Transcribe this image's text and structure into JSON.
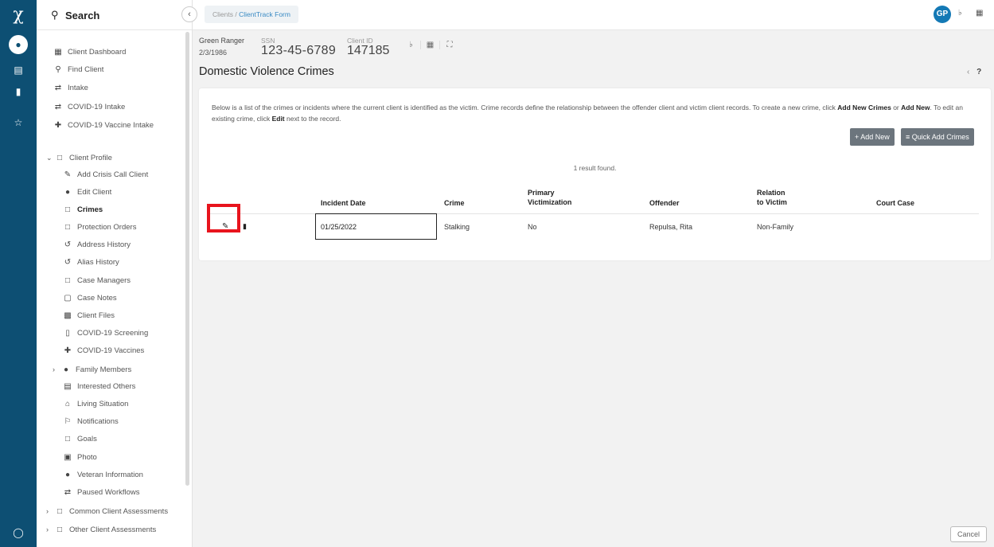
{
  "rail": {
    "icons": [
      "logo",
      "users-icon",
      "id-card-icon",
      "document-icon",
      "star-icon",
      "help-icon"
    ]
  },
  "sidebar": {
    "search_label": "Search",
    "top_items": [
      {
        "label": "Client Dashboard",
        "icon": "map-icon"
      },
      {
        "label": "Find Client",
        "icon": "search-icon"
      },
      {
        "label": "Intake",
        "icon": "workflow-icon"
      },
      {
        "label": "COVID-19 Intake",
        "icon": "workflow-icon"
      },
      {
        "label": "COVID-19 Vaccine Intake",
        "icon": "syringe-icon"
      }
    ],
    "section_label": "Client Profile",
    "profile_items": [
      {
        "label": "Add Crisis Call Client",
        "icon": "user-edit-icon"
      },
      {
        "label": "Edit Client",
        "icon": "user-icon"
      },
      {
        "label": "Crimes",
        "icon": "folder-icon",
        "active": true
      },
      {
        "label": "Protection Orders",
        "icon": "folder-icon"
      },
      {
        "label": "Address History",
        "icon": "history-icon"
      },
      {
        "label": "Alias History",
        "icon": "history-icon"
      },
      {
        "label": "Case Managers",
        "icon": "folder-icon"
      },
      {
        "label": "Case Notes",
        "icon": "note-icon"
      },
      {
        "label": "Client Files",
        "icon": "file-icon"
      },
      {
        "label": "COVID-19 Screening",
        "icon": "clipboard-icon"
      },
      {
        "label": "COVID-19 Vaccines",
        "icon": "syringe-icon"
      },
      {
        "label": "Family Members",
        "icon": "user-icon"
      },
      {
        "label": "Interested Others",
        "icon": "id-card-icon"
      },
      {
        "label": "Living Situation",
        "icon": "home-icon"
      },
      {
        "label": "Notifications",
        "icon": "flag-icon"
      },
      {
        "label": "Goals",
        "icon": "folder-icon"
      },
      {
        "label": "Photo",
        "icon": "image-icon"
      },
      {
        "label": "Veteran Information",
        "icon": "users-icon"
      },
      {
        "label": "Paused Workflows",
        "icon": "workflow-icon"
      }
    ],
    "bottom_items": [
      {
        "label": "Common Client Assessments"
      },
      {
        "label": "Other Client Assessments"
      }
    ]
  },
  "topbar": {
    "breadcrumb_root": "Clients",
    "breadcrumb_sep": "/",
    "breadcrumb_current": "ClientTrack Form",
    "avatar_initials": "GP"
  },
  "client": {
    "name": "Green Ranger",
    "dob": "2/3/1986",
    "ssn_label": "SSN",
    "ssn": "123-45-6789",
    "id_label": "Client ID",
    "id": "147185"
  },
  "page": {
    "title": "Domestic Violence Crimes",
    "intro_part1": "Below is a list of the crimes or incidents where the current client is identified as the victim.  Crime records define the relationship between the offender client and victim client records.  To create a new crime, click ",
    "intro_bold1": "Add New Crimes",
    "intro_part2": " or ",
    "intro_bold2": "Add New",
    "intro_part3": ".  To edit an existing crime, click ",
    "intro_bold3": "Edit",
    "intro_part4": " next to the record.",
    "add_new_label": "Add New",
    "quick_add_label": "Quick Add Crimes",
    "result_count": "1 result found.",
    "cancel_label": "Cancel"
  },
  "table": {
    "headers": {
      "incident_date": "Incident Date",
      "crime": "Crime",
      "primary_victimization_1": "Primary",
      "primary_victimization_2": "Victimization",
      "offender": "Offender",
      "relation_1": "Relation",
      "relation_2": "to Victim",
      "court_case": "Court Case"
    },
    "rows": [
      {
        "incident_date": "01/25/2022",
        "crime": "Stalking",
        "primary_victimization": "No",
        "offender": "Repulsa, Rita",
        "relation": "Non-Family",
        "court_case": ""
      }
    ]
  },
  "colors": {
    "rail_bg": "#0d4f73",
    "accent": "#1479b5",
    "highlight_box": "#e8141d",
    "button_bg": "#6c757d"
  }
}
